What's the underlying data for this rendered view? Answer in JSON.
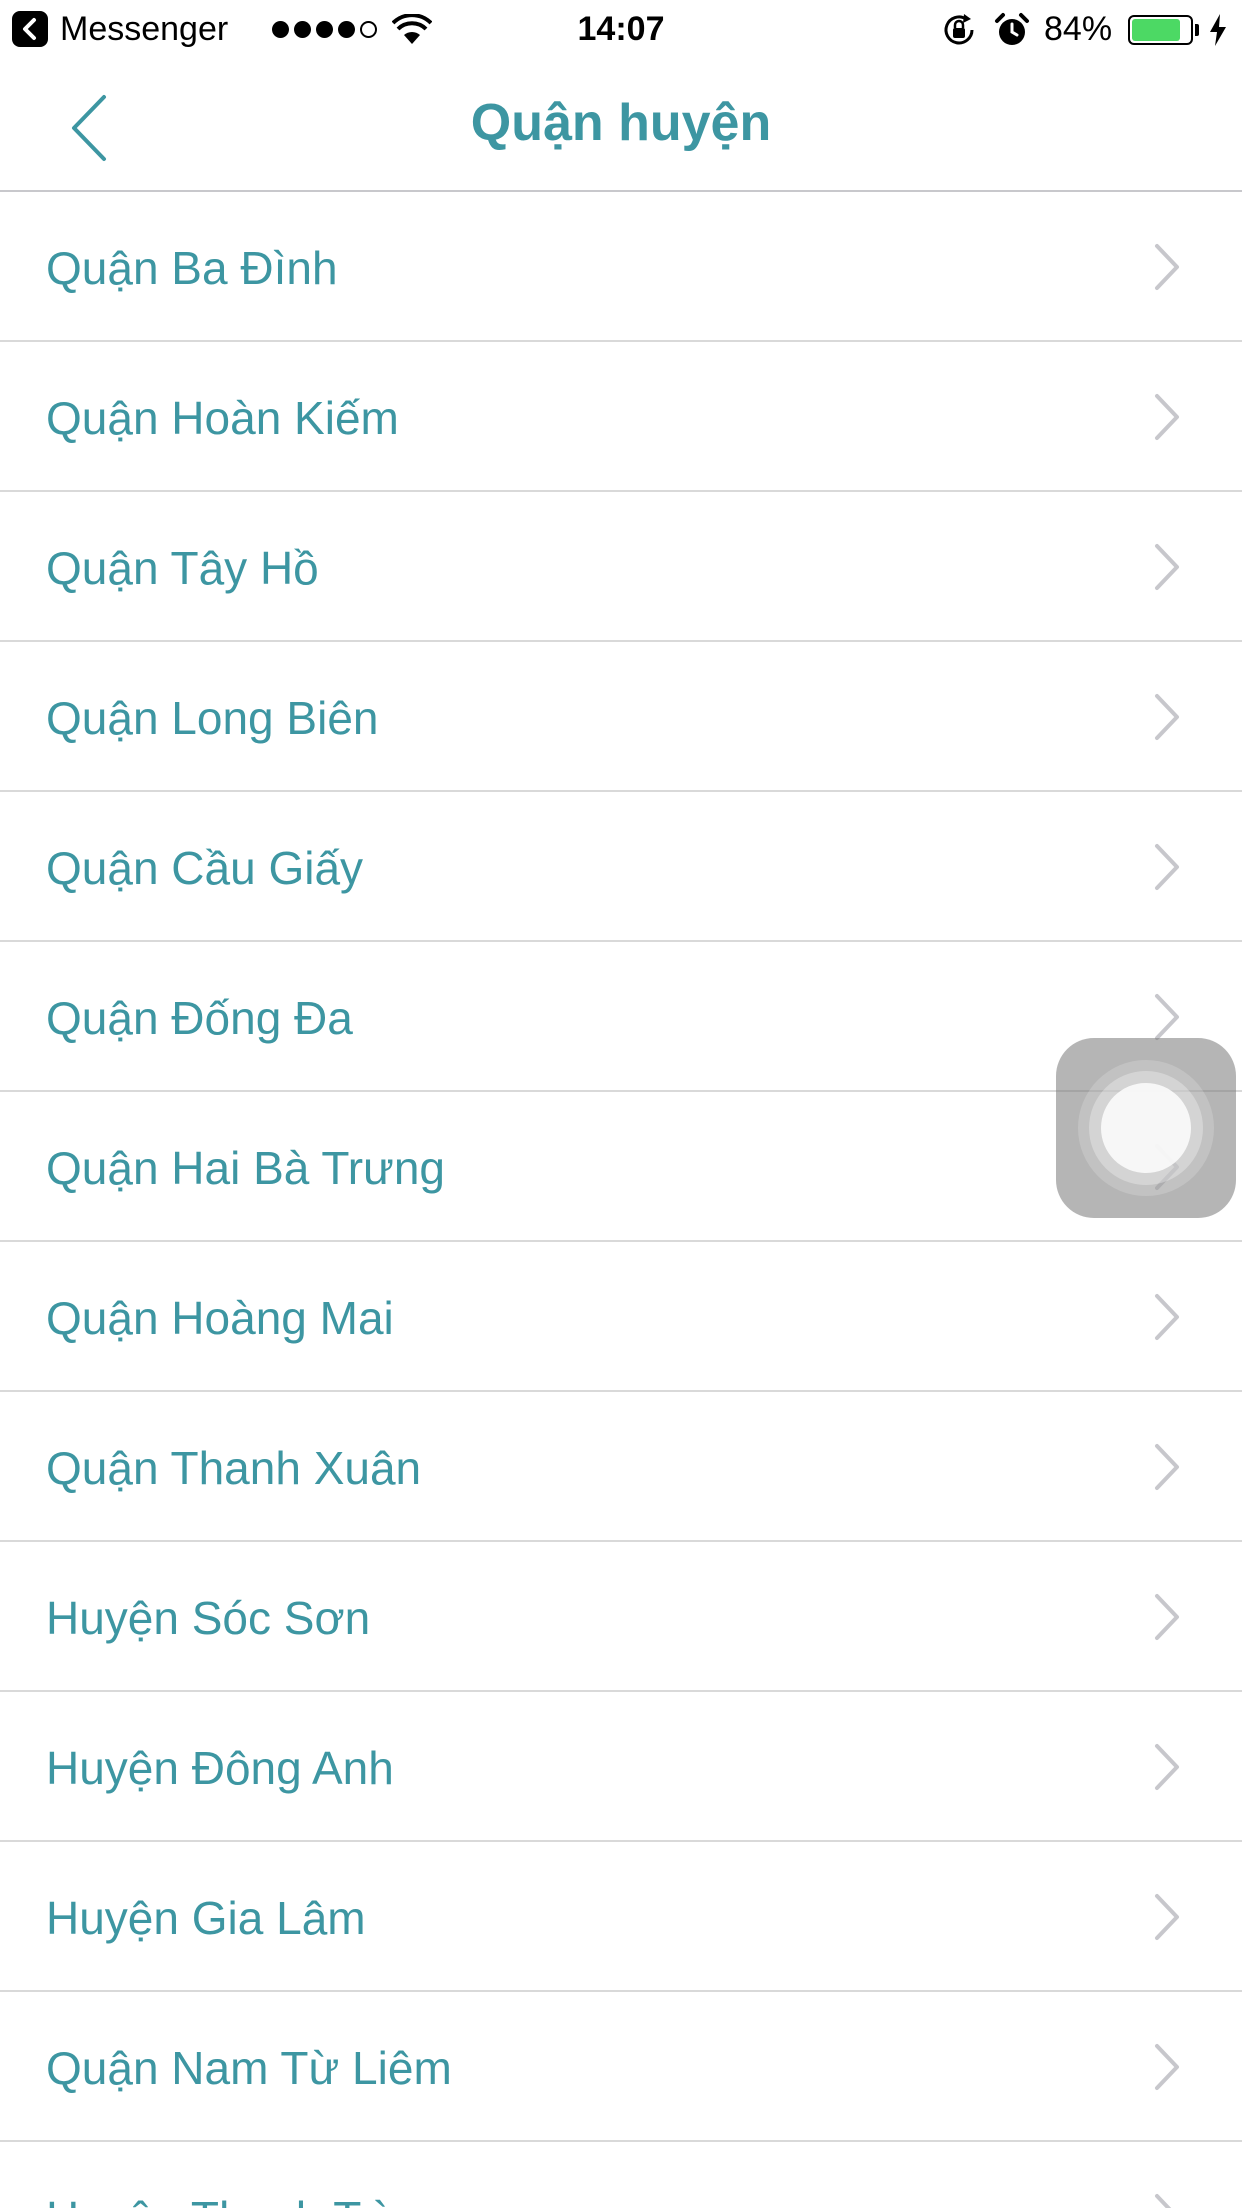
{
  "status_bar": {
    "back_app": "Messenger",
    "time": "14:07",
    "battery_percent": "84%",
    "battery_level": 0.84,
    "battery_color": "#4cd964",
    "signal_bars_filled": 4,
    "signal_bars_total": 5
  },
  "nav": {
    "title": "Quận huyện",
    "back_icon": "chevron-left-icon"
  },
  "theme": {
    "accent": "#3d96a2",
    "divider": "#d9d9d9",
    "chevron": "#c7c7cc"
  },
  "districts": [
    {
      "label": "Quận Ba Đình"
    },
    {
      "label": "Quận Hoàn Kiếm"
    },
    {
      "label": "Quận Tây Hồ"
    },
    {
      "label": "Quận Long Biên"
    },
    {
      "label": "Quận Cầu Giấy"
    },
    {
      "label": "Quận Đống Đa"
    },
    {
      "label": "Quận Hai Bà Trưng"
    },
    {
      "label": "Quận Hoàng Mai"
    },
    {
      "label": "Quận Thanh Xuân"
    },
    {
      "label": "Huyện Sóc Sơn"
    },
    {
      "label": "Huyện Đông Anh"
    },
    {
      "label": "Huyện Gia Lâm"
    },
    {
      "label": "Quận Nam Từ Liêm"
    },
    {
      "label": "Huyện Thanh Trì"
    }
  ]
}
